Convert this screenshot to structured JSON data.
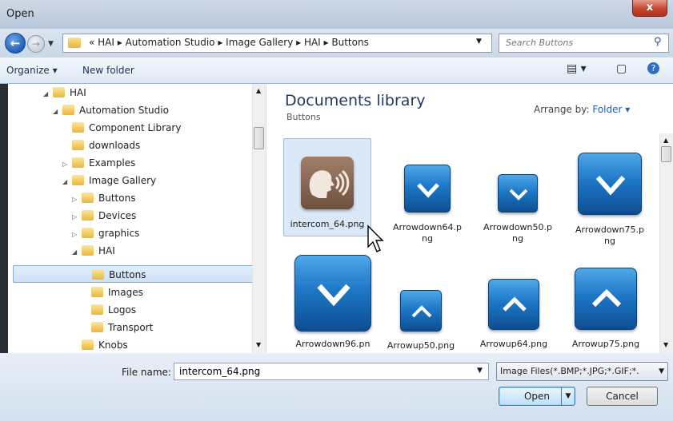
{
  "window": {
    "title": "Open",
    "close_label": "x"
  },
  "address": {
    "crumbs": "« HAI ▸ Automation Studio ▸ Image Gallery ▸ HAI ▸ Buttons",
    "search_placeholder": "Search Buttons"
  },
  "toolbar": {
    "organize_label": "Organize ▾",
    "new_folder_label": "New folder"
  },
  "tree": {
    "items": [
      {
        "label": "HAI",
        "arrow": "◢"
      },
      {
        "label": "Automation Studio",
        "arrow": "◢"
      },
      {
        "label": "Component Library",
        "arrow": ""
      },
      {
        "label": "downloads",
        "arrow": ""
      },
      {
        "label": "Examples",
        "arrow": "▷"
      },
      {
        "label": "Image Gallery",
        "arrow": "◢"
      },
      {
        "label": "Buttons",
        "arrow": "▷"
      },
      {
        "label": "Devices",
        "arrow": "▷"
      },
      {
        "label": "graphics",
        "arrow": "▷"
      },
      {
        "label": "HAI",
        "arrow": "◢"
      },
      {
        "label": "Buttons",
        "arrow": ""
      },
      {
        "label": "Images",
        "arrow": ""
      },
      {
        "label": "Logos",
        "arrow": ""
      },
      {
        "label": "Transport",
        "arrow": ""
      },
      {
        "label": "Knobs",
        "arrow": ""
      }
    ]
  },
  "library": {
    "title": "Documents library",
    "subtitle": "Buttons",
    "arrange_label": "Arrange by:",
    "arrange_value": "Folder ▾"
  },
  "files": [
    {
      "name": "intercom_64.png",
      "icon": "intercom-icon"
    },
    {
      "name": "Arrowdown64.png",
      "icon": "arrow-down-icon"
    },
    {
      "name": "Arrowdown50.png",
      "icon": "arrow-down-icon"
    },
    {
      "name": "Arrowdown75.png",
      "icon": "arrow-down-icon"
    },
    {
      "name": "Arrowdown96.pn",
      "icon": "arrow-down-icon"
    },
    {
      "name": "Arrowup50.png",
      "icon": "arrow-up-icon"
    },
    {
      "name": "Arrowup64.png",
      "icon": "arrow-up-icon"
    },
    {
      "name": "Arrowup75.png",
      "icon": "arrow-up-icon"
    }
  ],
  "bottom": {
    "filename_label": "File name:",
    "filename_value": "intercom_64.png",
    "filetype_value": "Image Files(*.BMP;*.JPG;*.GIF;*.",
    "open_label": "Open",
    "cancel_label": "Cancel"
  },
  "colors": {
    "accent": "#1e78c7",
    "selection": "#cde0f7"
  }
}
